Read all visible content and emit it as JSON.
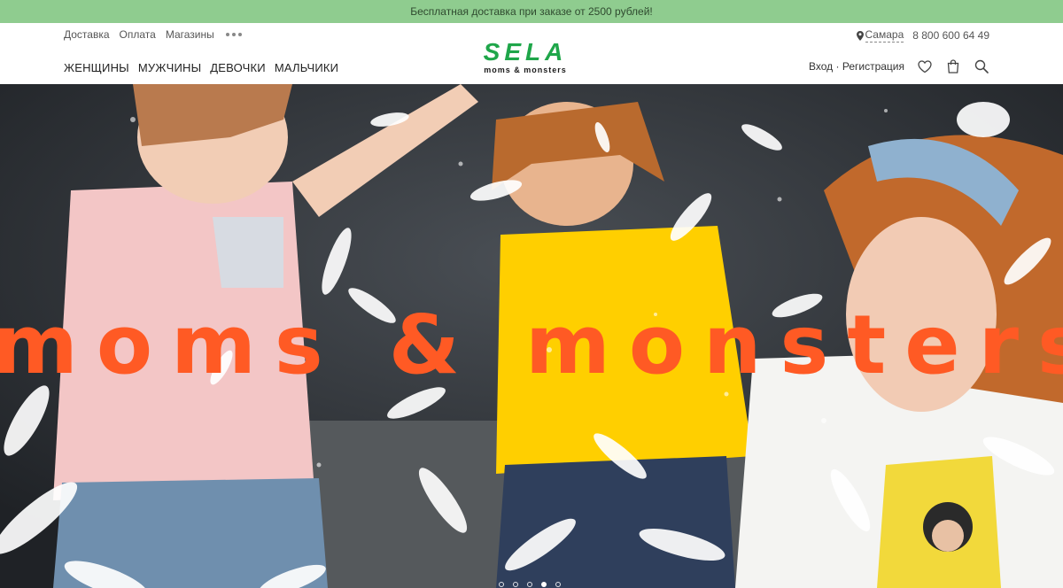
{
  "promo": {
    "text": "Бесплатная доставка при заказе от 2500 рублей!"
  },
  "top_links": [
    "Доставка",
    "Оплата",
    "Магазины"
  ],
  "main_nav": [
    "ЖЕНЩИНЫ",
    "МУЖЧИНЫ",
    "ДЕВОЧКИ",
    "МАЛЬЧИКИ"
  ],
  "logo": {
    "main": "SELA",
    "sub": "moms & monsters",
    "color": "#1fa64a"
  },
  "region": {
    "city": "Самара",
    "phone": "8 800 600 64 49"
  },
  "auth": {
    "label": "Вход · Регистрация"
  },
  "icons": {
    "favorites": "heart-icon",
    "cart": "shopping-bag-icon",
    "search": "search-icon",
    "location": "map-pin-icon",
    "more": "more-dots-icon"
  },
  "hero": {
    "title": "moms & monsters",
    "title_color": "#ff5a24",
    "slides_total": 5,
    "active_slide": 4
  },
  "colors": {
    "promo_bg": "#8fcc8f",
    "accent": "#1fa64a"
  }
}
